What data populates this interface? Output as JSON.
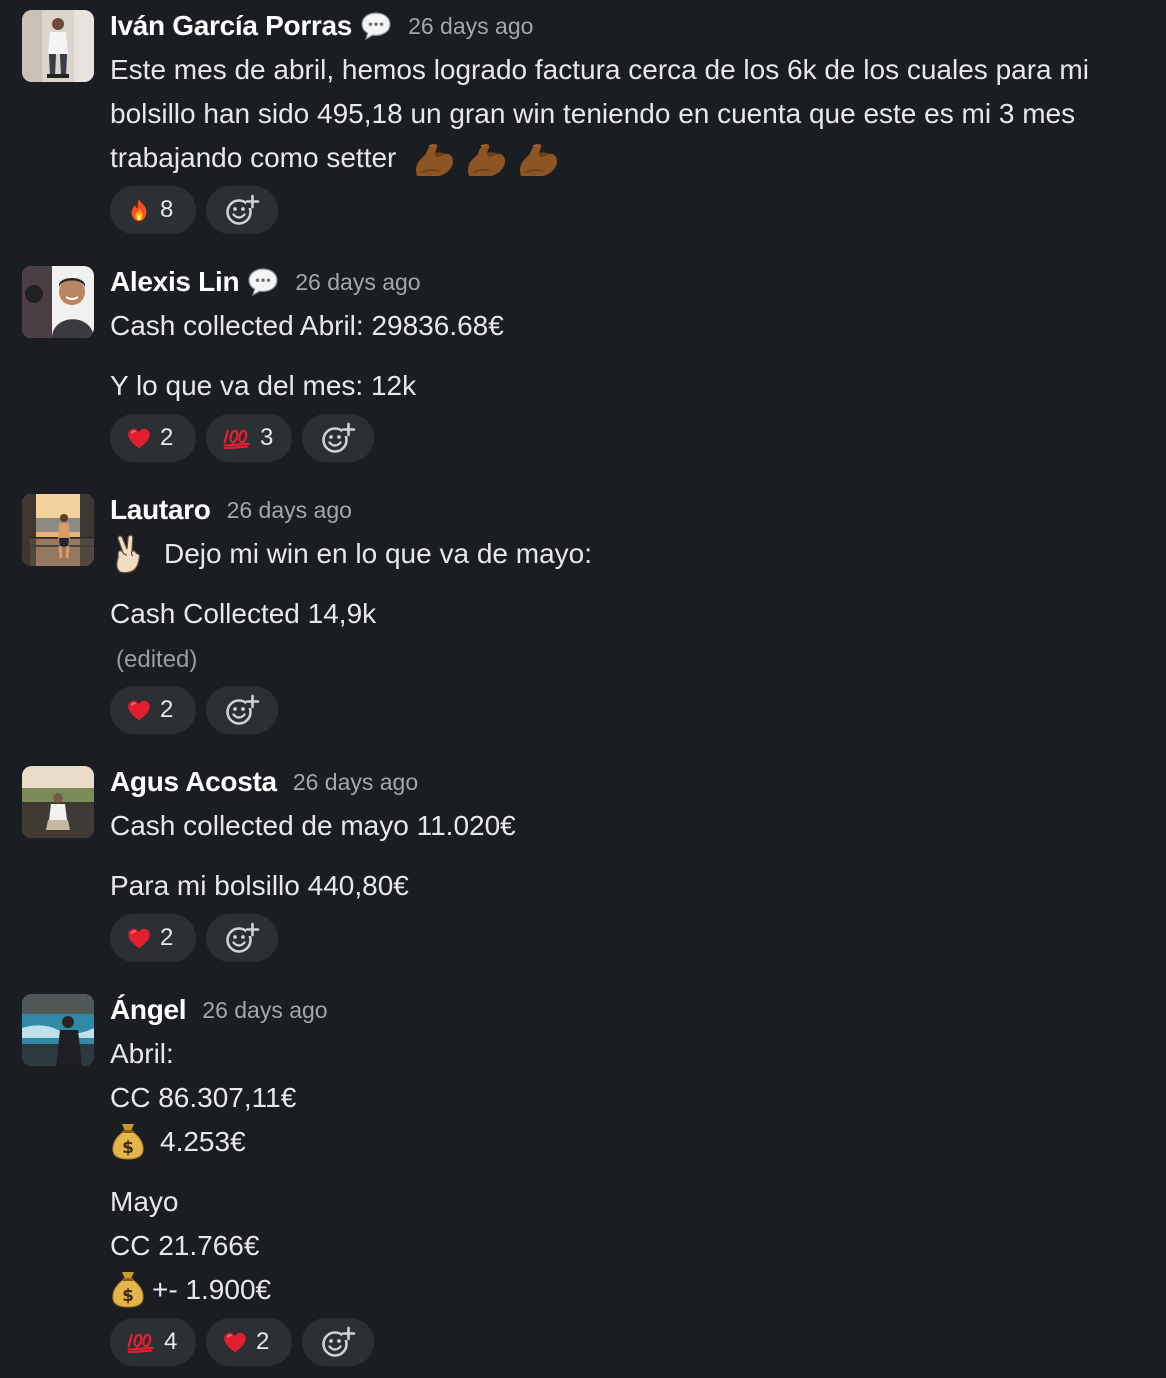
{
  "messages": [
    {
      "author": "Iván García Porras",
      "has_thread_icon": true,
      "timestamp": "26 days ago",
      "lines": [
        "Este mes de abril, hemos logrado factura cerca de los 6k de los cuales para mi",
        "bolsillo han sido 495,18 un gran win teniendo en cuenta que este es mi 3 mes",
        "trabajando como setter"
      ],
      "trailing_emoji": "flexed-biceps x3",
      "reactions": [
        {
          "emoji": "fire-icon",
          "count": "8"
        }
      ]
    },
    {
      "author": "Alexis Lin",
      "has_thread_icon": true,
      "timestamp": "26 days ago",
      "lines": [
        "Cash collected Abril: 29836.68€",
        "Y lo que va del mes: 12k"
      ],
      "reactions": [
        {
          "emoji": "heart-icon",
          "count": "2"
        },
        {
          "emoji": "hundred-points-icon",
          "count": "3"
        }
      ]
    },
    {
      "author": "Lautaro",
      "timestamp": "26 days ago",
      "lines": [
        "Dejo mi win en lo que va de mayo:",
        "Cash Collected 14,9k"
      ],
      "edited_label": "(edited)",
      "reactions": [
        {
          "emoji": "heart-icon",
          "count": "2"
        }
      ]
    },
    {
      "author": "Agus Acosta",
      "timestamp": "26 days ago",
      "lines": [
        "Cash collected de mayo 11.020€",
        "Para mi bolsillo 440,80€"
      ],
      "reactions": [
        {
          "emoji": "heart-icon",
          "count": "2"
        }
      ]
    },
    {
      "author": "Ángel",
      "timestamp": "26 days ago",
      "lines": [
        "Abril:",
        "CC 86.307,11€",
        "4.253€",
        "Mayo",
        "CC 21.766€",
        "+- 1.900€"
      ],
      "reactions": [
        {
          "emoji": "hundred-points-icon",
          "count": "4"
        },
        {
          "emoji": "heart-icon",
          "count": "2"
        }
      ]
    }
  ],
  "colors": {
    "background": "#1a1d21",
    "pill": "#2c2f33",
    "author": "#ffffff",
    "timestamp": "#a5a7a9",
    "text": "#e8e8e8"
  }
}
